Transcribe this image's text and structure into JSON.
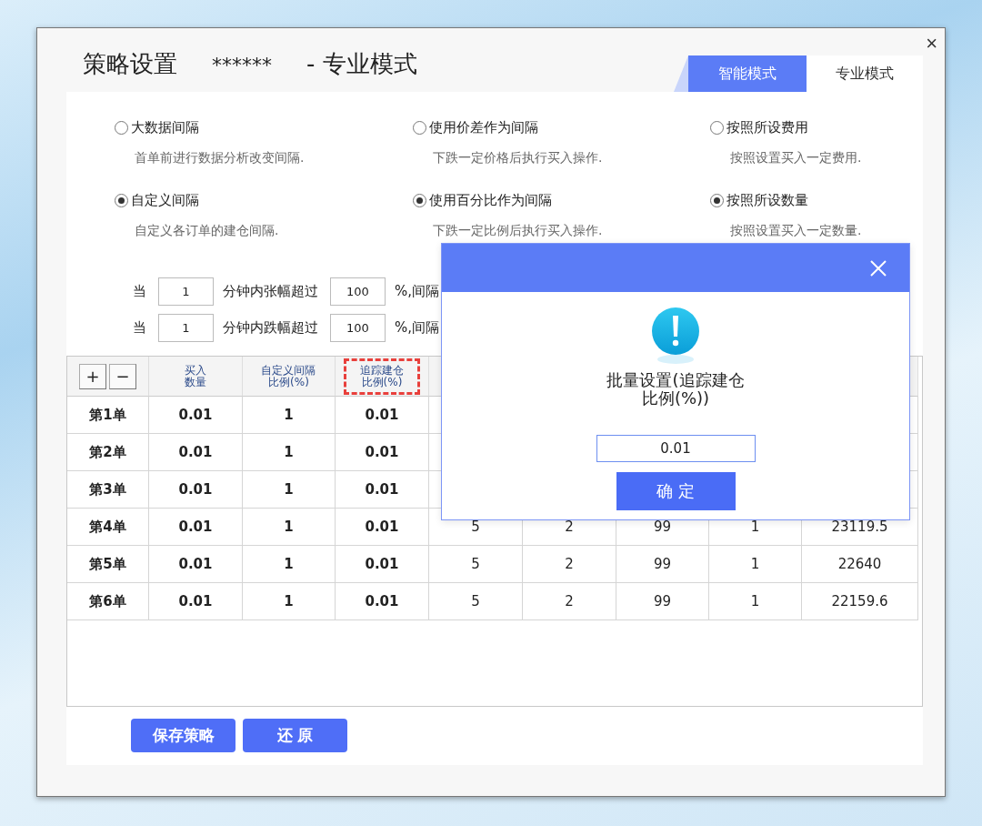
{
  "window": {
    "title": "策略设置",
    "account": "******",
    "mode": "- 专业模式",
    "close": "×"
  },
  "tabs": [
    {
      "label": "智能模式",
      "selected": false
    },
    {
      "label": "专业模式",
      "selected": true
    }
  ],
  "option_groups": [
    {
      "options": [
        {
          "label": "大数据间隔",
          "description": "首单前进行数据分析改变间隔.",
          "selected": false
        },
        {
          "label": "自定义间隔",
          "description": "自定义各订单的建仓间隔.",
          "selected": true
        }
      ]
    },
    {
      "options": [
        {
          "label": "使用价差作为间隔",
          "description": "下跌一定价格后执行买入操作.",
          "selected": false
        },
        {
          "label": "使用百分比作为间隔",
          "description": "下跌一定比例后执行买入操作.",
          "selected": true
        }
      ]
    },
    {
      "options": [
        {
          "label": "按照所设费用",
          "description": "按照设置买入一定费用.",
          "selected": false
        },
        {
          "label": "按照所设数量",
          "description": "按照设置买入一定数量.",
          "selected": true
        }
      ]
    }
  ],
  "rules": [
    {
      "prefix": "当",
      "minutes": "1",
      "condition": "分钟内张幅超过",
      "percent": "100",
      "suffix": "%,间隔"
    },
    {
      "prefix": "当",
      "minutes": "1",
      "condition": "分钟内跌幅超过",
      "percent": "100",
      "suffix": "%,间隔"
    }
  ],
  "table": {
    "columns": [
      {
        "kind": "buttons",
        "add": "+",
        "remove": "−"
      },
      {
        "kind": "text",
        "text": "买入数量",
        "highlighted": false
      },
      {
        "kind": "text",
        "text": "自定义间隔比例(%)",
        "highlighted": false
      },
      {
        "kind": "text",
        "text": "追踪建仓比例(%)",
        "highlighted": true
      }
    ],
    "rows": [
      {
        "cells": [
          "第1单",
          "0.01",
          "1",
          "0.01"
        ]
      },
      {
        "cells": [
          "第2单",
          "0.01",
          "1",
          "0.01"
        ]
      },
      {
        "cells": [
          "第3单",
          "0.01",
          "1",
          "0.01"
        ]
      },
      {
        "cells": [
          "第4单",
          "0.01",
          "1",
          "0.01",
          "5",
          "2",
          "99",
          "1",
          "23119.5"
        ]
      },
      {
        "cells": [
          "第5单",
          "0.01",
          "1",
          "0.01",
          "5",
          "2",
          "99",
          "1",
          "22640"
        ]
      },
      {
        "cells": [
          "第6单",
          "0.01",
          "1",
          "0.01",
          "5",
          "2",
          "99",
          "1",
          "22159.6"
        ]
      }
    ]
  },
  "buttons": [
    "保存策略",
    "还 原"
  ],
  "dialog": {
    "message": "批量设置(追踪建仓比例(%))",
    "value": "0.01",
    "confirm": "确 定"
  }
}
